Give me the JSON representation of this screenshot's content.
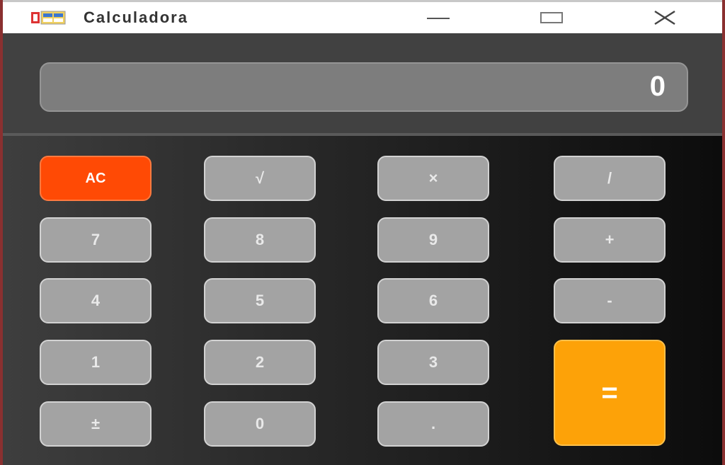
{
  "window": {
    "title": "Calculadora",
    "minimize_icon": "minimize-icon",
    "maximize_icon": "maximize-icon",
    "close_icon": "close-icon"
  },
  "display": {
    "value": "0"
  },
  "keys": {
    "ac": "AC",
    "sqrt": "√",
    "multiply": "×",
    "divide": "/",
    "seven": "7",
    "eight": "8",
    "nine": "9",
    "plus": "+",
    "four": "4",
    "five": "5",
    "six": "6",
    "minus": "-",
    "one": "1",
    "two": "2",
    "three": "3",
    "equals": "=",
    "plus_minus": "±",
    "zero": "0",
    "decimal": "."
  },
  "colors": {
    "ac_button": "#ff4a05",
    "equals_button": "#fda208",
    "key_gray": "#a3a3a3",
    "display_bg": "#7d7d7d"
  }
}
